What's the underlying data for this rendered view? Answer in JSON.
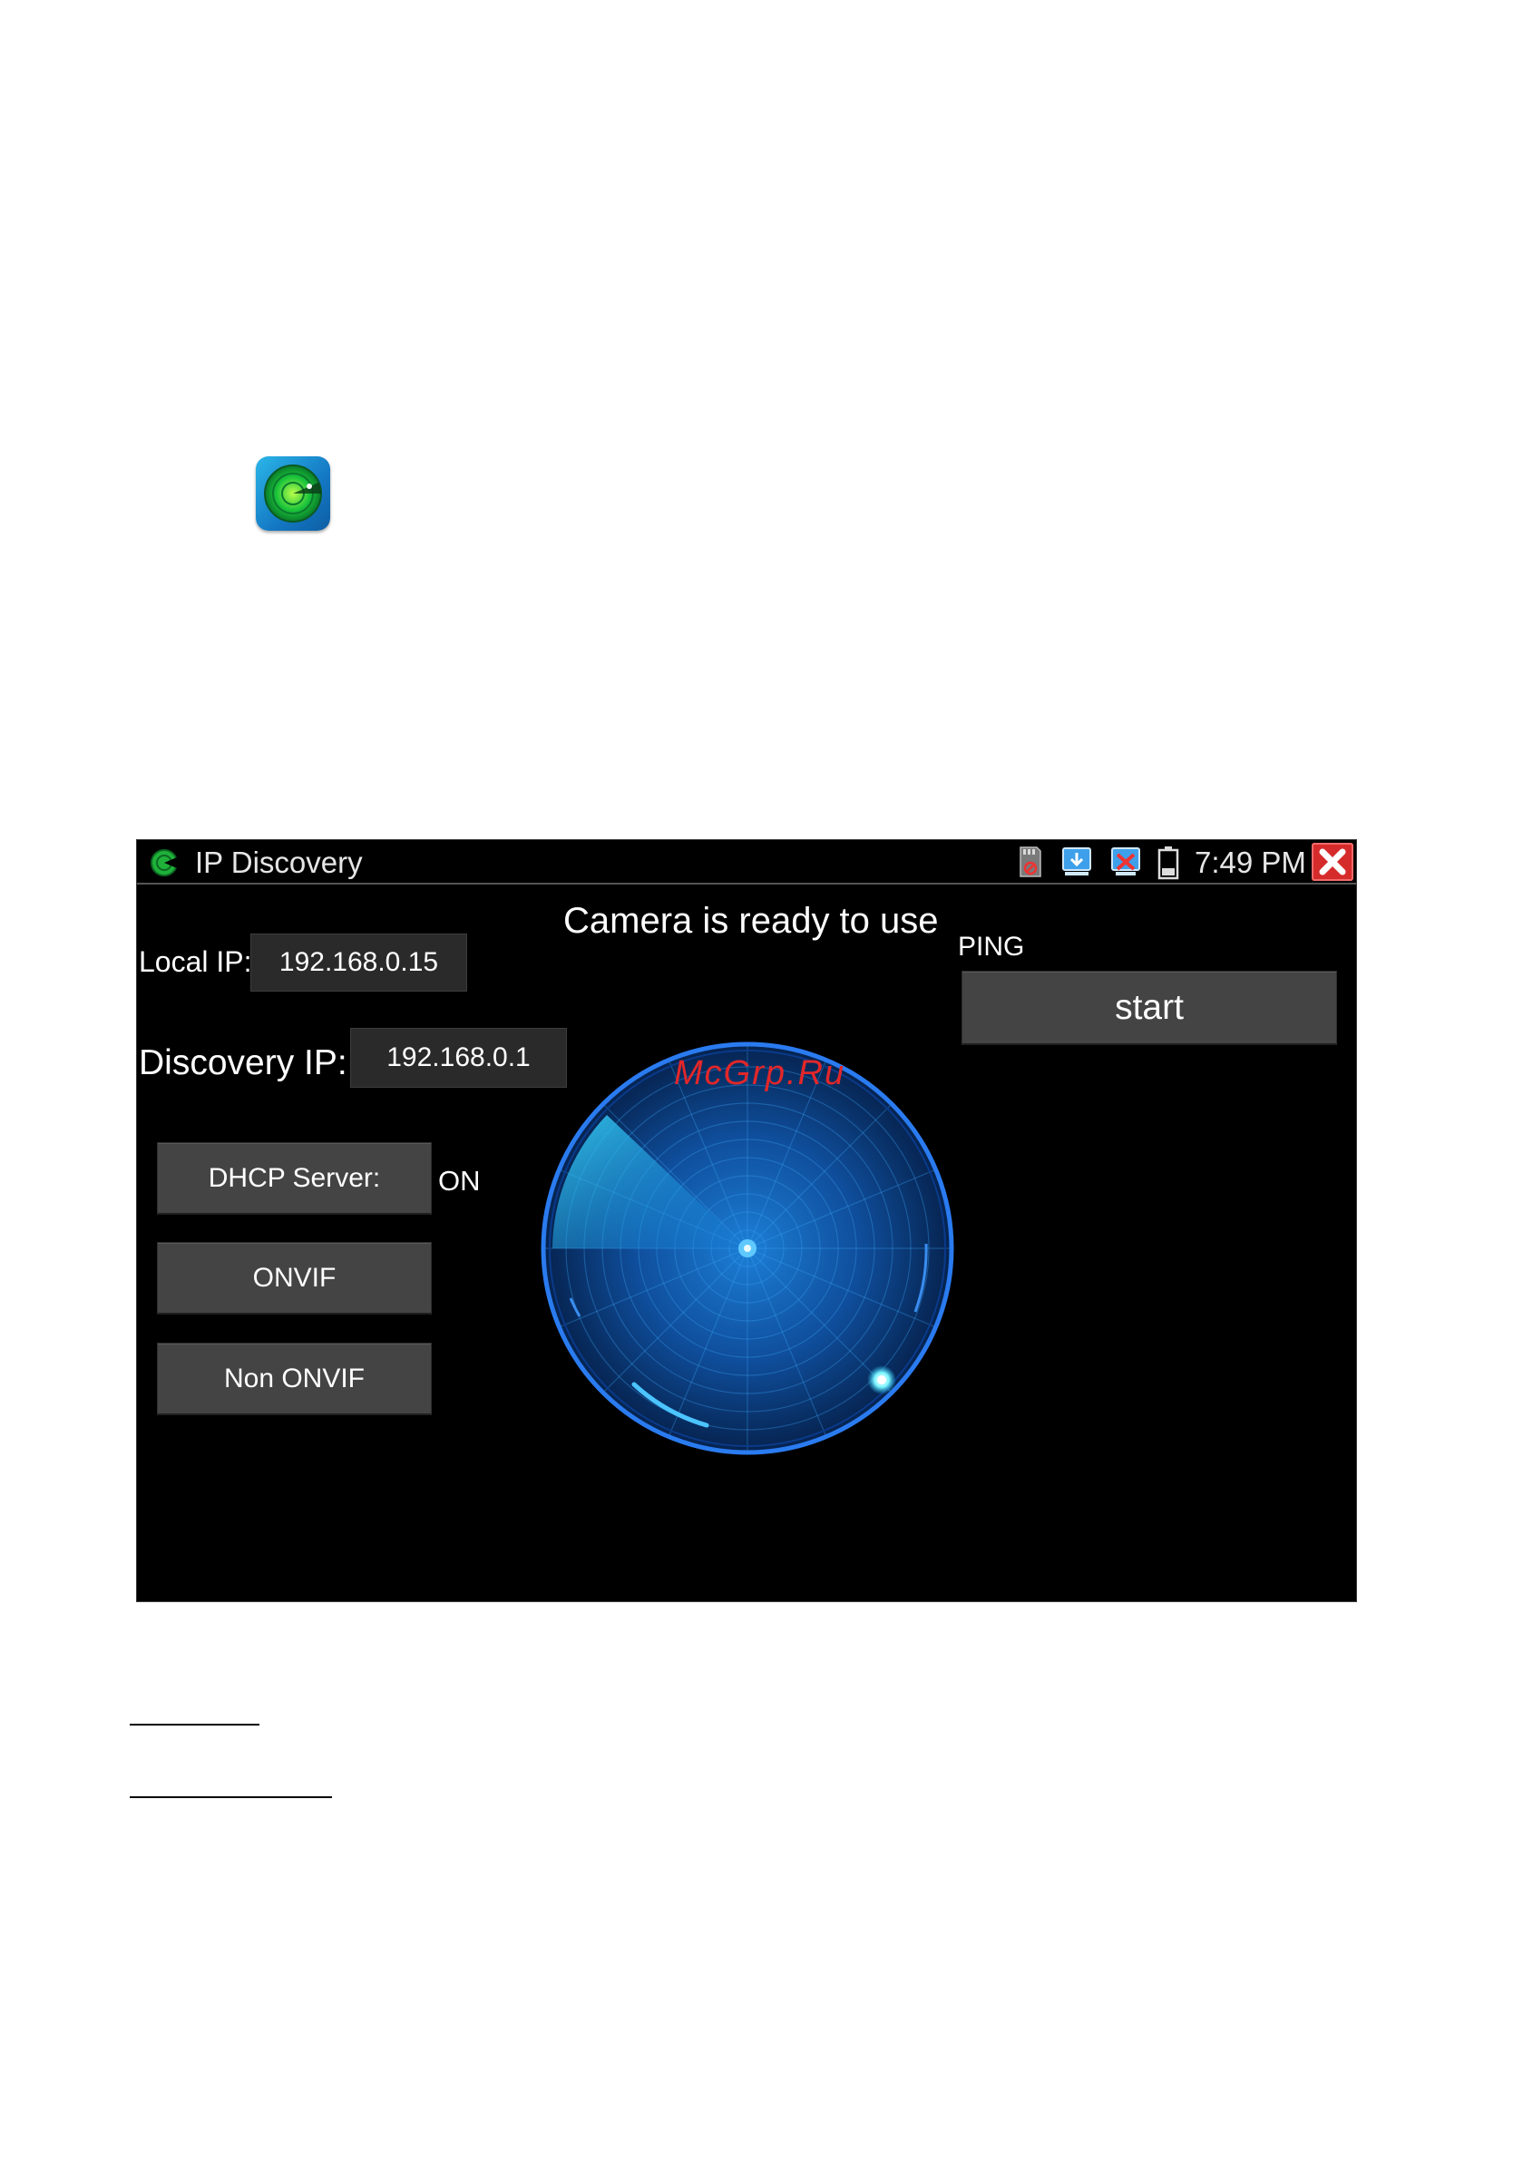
{
  "device": {
    "app_title": "IP Discovery",
    "clock": "7:49 PM",
    "status_message": "Camera is ready to use",
    "local_ip": {
      "label": "Local IP:",
      "value": "192.168.0.15"
    },
    "discovery_ip": {
      "label": "Discovery IP:",
      "value": "192.168.0.1"
    },
    "dhcp": {
      "button_label": "DHCP Server:",
      "state": "ON"
    },
    "onvif_button": "ONVIF",
    "non_onvif_button": "Non ONVIF",
    "ping": {
      "label": "PING",
      "start_button": "start"
    },
    "watermark": "McGrp.Ru",
    "icons": [
      "sd-card-icon",
      "download-icon",
      "network-disconnected-icon",
      "battery-icon",
      "close-icon"
    ]
  },
  "colors": {
    "screen_bg": "#000000",
    "button_bg": "#444444",
    "field_bg": "#2a2a2a",
    "radar_blue": "#1e88ff",
    "close_red": "#d62b2b"
  }
}
